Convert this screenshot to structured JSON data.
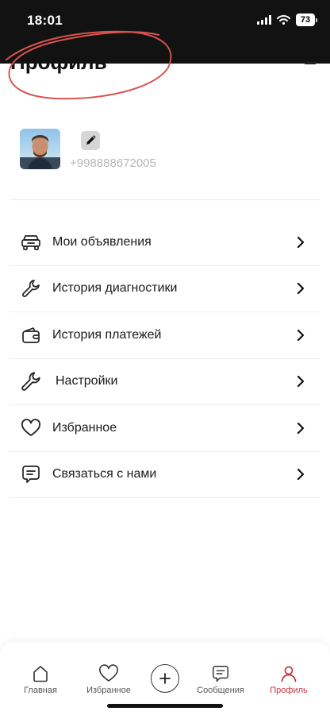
{
  "status_bar": {
    "time": "18:01",
    "battery": "73"
  },
  "header": {
    "title": "Профиль"
  },
  "profile": {
    "phone": "+998888672005"
  },
  "menu": [
    {
      "label": "Мои объявления",
      "icon": "car-icon"
    },
    {
      "label": "История диагностики",
      "icon": "wrench-icon"
    },
    {
      "label": "История платежей",
      "icon": "wallet-icon"
    },
    {
      "label": "Настройки",
      "icon": "wrench-icon"
    },
    {
      "label": "Избранное",
      "icon": "heart-icon"
    },
    {
      "label": "Связаться с нами",
      "icon": "chat-icon"
    }
  ],
  "bottom_nav": {
    "home": "Главная",
    "favorites": "Избранное",
    "messages": "Сообщения",
    "profile": "Профиль"
  },
  "colors": {
    "accent": "#c8343a",
    "annotation": "#d9534f",
    "status_bar_bg": "#121212"
  }
}
